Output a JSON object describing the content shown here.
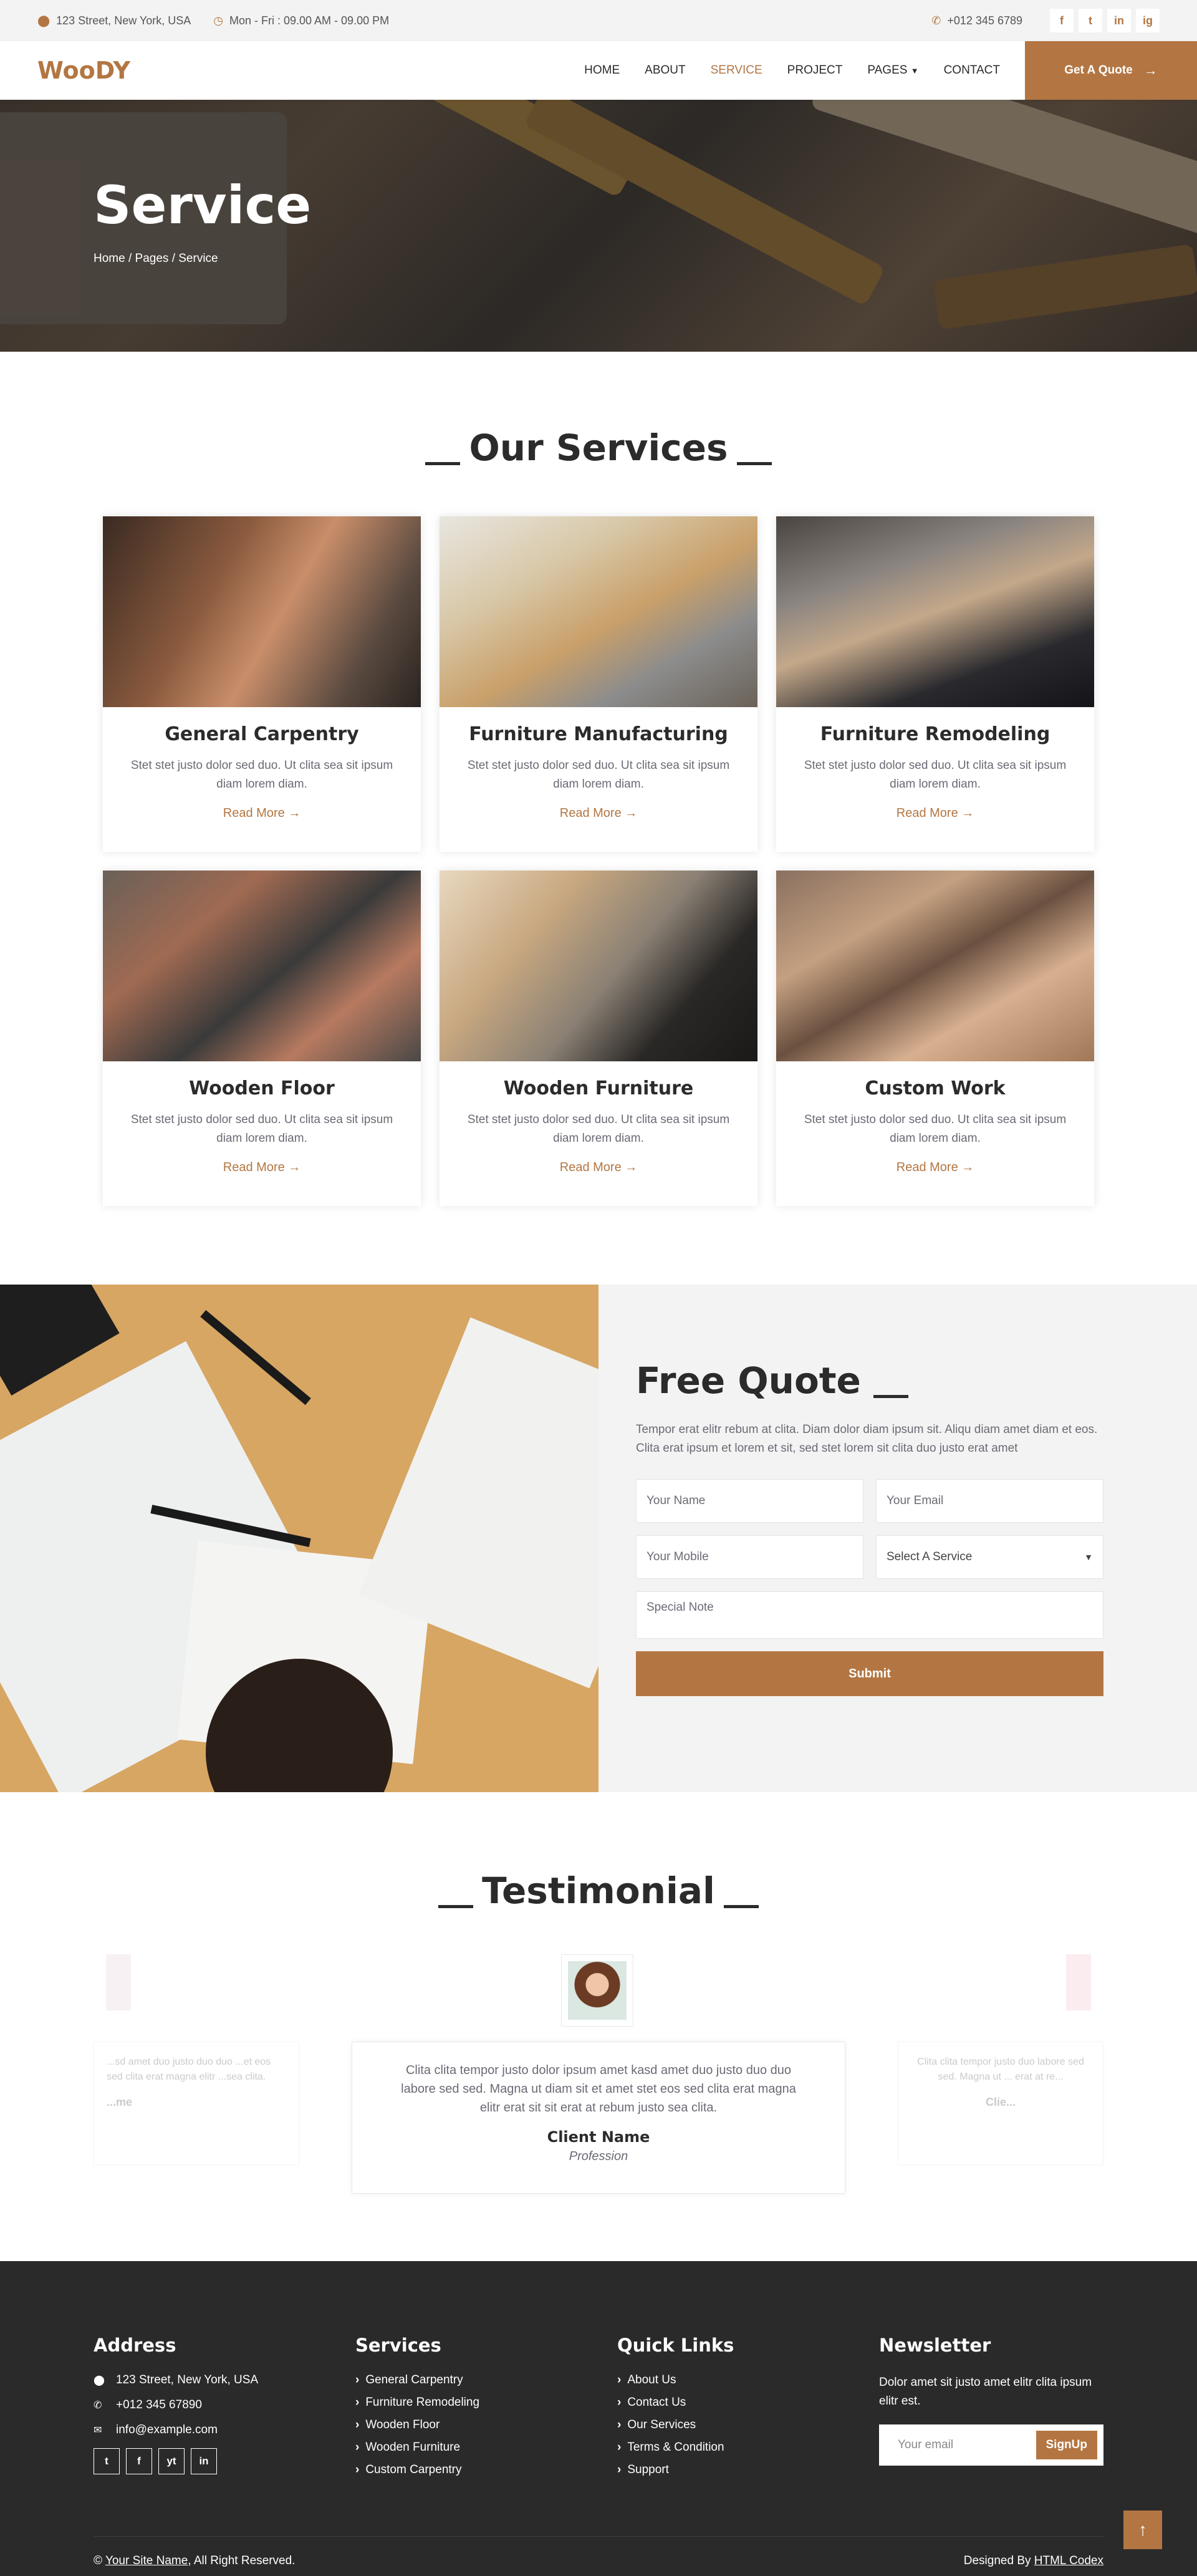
{
  "topbar": {
    "address": "123 Street, New York, USA",
    "hours": "Mon - Fri : 09.00 AM - 09.00 PM",
    "phone": "+012 345 6789",
    "social": [
      "f",
      "t",
      "in",
      "ig"
    ]
  },
  "navbar": {
    "logo": "WooDY",
    "items": [
      "HOME",
      "ABOUT",
      "SERVICE",
      "PROJECT",
      "PAGES",
      "CONTACT"
    ],
    "active": "SERVICE",
    "cta": "Get A Quote"
  },
  "hero": {
    "title": "Service",
    "breadcrumb": [
      "Home",
      "Pages",
      "Service"
    ]
  },
  "services": {
    "title": "Our Services",
    "items": [
      {
        "title": "General Carpentry",
        "text": "Stet stet justo dolor sed duo. Ut clita sea sit ipsum diam lorem diam.",
        "link": "Read More"
      },
      {
        "title": "Furniture Manufacturing",
        "text": "Stet stet justo dolor sed duo. Ut clita sea sit ipsum diam lorem diam.",
        "link": "Read More"
      },
      {
        "title": "Furniture Remodeling",
        "text": "Stet stet justo dolor sed duo. Ut clita sea sit ipsum diam lorem diam.",
        "link": "Read More"
      },
      {
        "title": "Wooden Floor",
        "text": "Stet stet justo dolor sed duo. Ut clita sea sit ipsum diam lorem diam.",
        "link": "Read More"
      },
      {
        "title": "Wooden Furniture",
        "text": "Stet stet justo dolor sed duo. Ut clita sea sit ipsum diam lorem diam.",
        "link": "Read More"
      },
      {
        "title": "Custom Work",
        "text": "Stet stet justo dolor sed duo. Ut clita sea sit ipsum diam lorem diam.",
        "link": "Read More"
      }
    ]
  },
  "quote": {
    "title": "Free Quote",
    "text": "Tempor erat elitr rebum at clita. Diam dolor diam ipsum sit. Aliqu diam amet diam et eos. Clita erat ipsum et lorem et sit, sed stet lorem sit clita duo justo erat amet",
    "name_placeholder": "Your Name",
    "email_placeholder": "Your Email",
    "mobile_placeholder": "Your Mobile",
    "service_select": "Select A Service",
    "note_placeholder": "Special Note",
    "submit": "Submit"
  },
  "testimonial": {
    "title": "Testimonial",
    "main": {
      "text": "Clita clita tempor justo dolor ipsum amet kasd amet duo justo duo duo labore sed sed. Magna ut diam sit et amet stet eos sed clita erat magna elitr erat sit sit erat at rebum justo sea clita.",
      "name": "Client Name",
      "profession": "Profession"
    },
    "left_snippet": "...sd amet duo justo duo duo ...et eos sed clita erat magna elitr ...sea clita.",
    "left_name": "...me",
    "right_snippet": "Clita clita tempor justo duo labore sed sed. Magna ut ... erat at re...",
    "right_name": "Clie..."
  },
  "footer": {
    "address_title": "Address",
    "address": "123 Street, New York, USA",
    "phone": "+012 345 67890",
    "email": "info@example.com",
    "social": [
      "t",
      "f",
      "yt",
      "in"
    ],
    "services_title": "Services",
    "services": [
      "General Carpentry",
      "Furniture Remodeling",
      "Wooden Floor",
      "Wooden Furniture",
      "Custom Carpentry"
    ],
    "links_title": "Quick Links",
    "links": [
      "About Us",
      "Contact Us",
      "Our Services",
      "Terms & Condition",
      "Support"
    ],
    "newsletter_title": "Newsletter",
    "newsletter_text": "Dolor amet sit justo amet elitr clita ipsum elitr est.",
    "email_placeholder": "Your email",
    "signup": "SignUp",
    "copyright_prefix": "©",
    "site_name": "Your Site Name",
    "rights": ", All Right Reserved.",
    "designed_by": "Designed By",
    "codex": "HTML Codex"
  },
  "colors": {
    "accent": "#b37642",
    "dark": "#2b2a2a",
    "light": "#f3f3f3"
  }
}
